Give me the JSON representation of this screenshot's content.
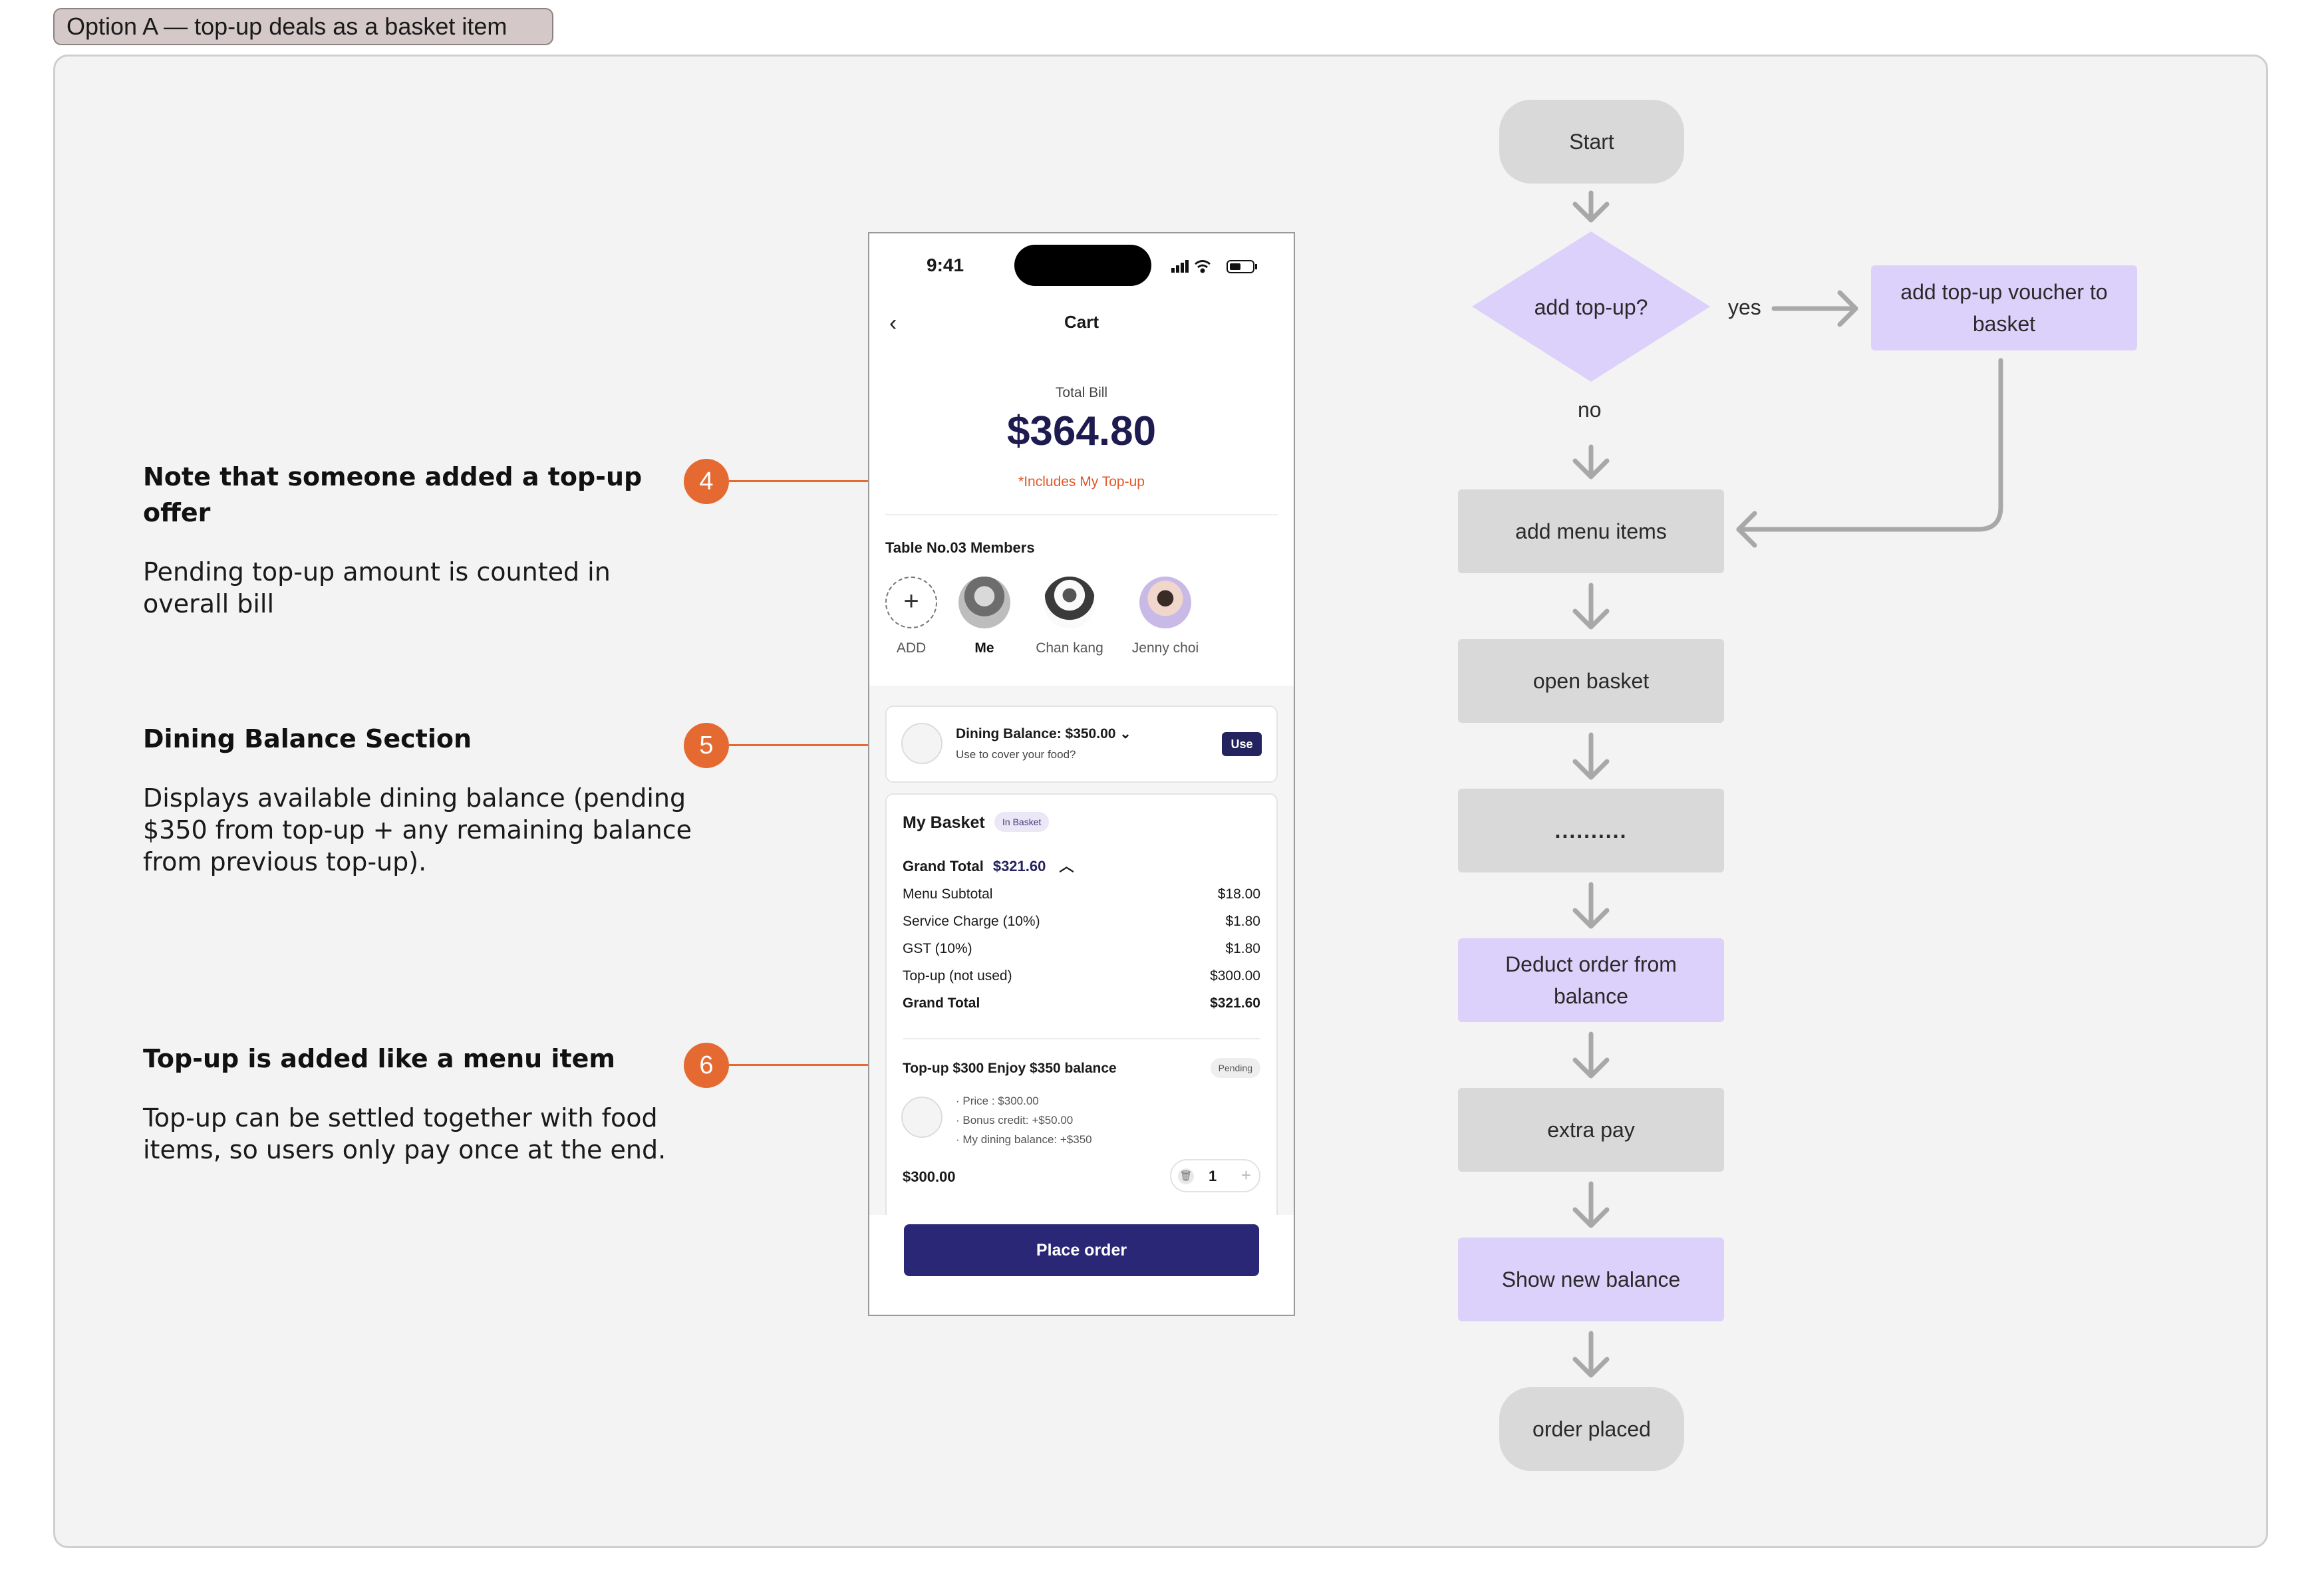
{
  "frame_title": "Option A — top-up deals as a basket item",
  "annotations": [
    {
      "number": "4",
      "title": "Note that someone added a top-up offer",
      "body": "Pending top-up amount is counted in overall bill"
    },
    {
      "number": "5",
      "title": "Dining Balance Section",
      "body": "Displays available dining balance (pending $350 from top-up + any remaining balance from previous top-up)."
    },
    {
      "number": "6",
      "title": "Top-up is added like a menu item",
      "body": "Top-up can be settled together with food items, so users only pay once at the end."
    }
  ],
  "phone": {
    "time": "9:41",
    "back_icon": "chevron-left-icon",
    "title": "Cart",
    "total_label": "Total Bill",
    "total_amount": "$364.80",
    "includes_note": "*Includes My Top-up",
    "members_title": "Table No.03 Members",
    "members": [
      {
        "label": "ADD",
        "icon": "plus-icon"
      },
      {
        "label": "Me"
      },
      {
        "label": "Chan kang"
      },
      {
        "label": "Jenny choi"
      }
    ],
    "dining_balance": {
      "label": "Dining Balance: $350.00",
      "sub": "Use to cover your food?",
      "button": "Use"
    },
    "basket": {
      "title": "My Basket",
      "badge": "In Basket",
      "grand_total_label": "Grand Total",
      "grand_total_value": "$321.60",
      "lines": [
        {
          "label": "Menu Subtotal",
          "value": "$18.00"
        },
        {
          "label": "Service Charge (10%)",
          "value": "$1.80"
        },
        {
          "label": "GST (10%)",
          "value": "$1.80"
        },
        {
          "label": "Top-up (not used)",
          "value": "$300.00"
        },
        {
          "label": "Grand Total",
          "value": "$321.60"
        }
      ],
      "topup": {
        "title": "Top-up $300 Enjoy $350 balance",
        "status": "Pending",
        "details": [
          "· Price : $300.00",
          "· Bonus credit: +$50.00",
          "· My dining balance: +$350"
        ],
        "price": "$300.00",
        "quantity": "1"
      }
    },
    "place_order": "Place order"
  },
  "flowchart": {
    "start": "Start",
    "decision": "add top-up?",
    "yes_label": "yes",
    "no_label": "no",
    "yes_action": "add top-up voucher to basket",
    "steps": [
      "add menu items",
      "open basket",
      "..........",
      "Deduct order from balance",
      "extra pay",
      "Show new balance"
    ],
    "end": "order placed"
  },
  "colors": {
    "accent_orange": "#e56a32",
    "primary_navy": "#2a2876",
    "flow_purple": "#dcd1fb",
    "flow_grey": "#d9d9d9"
  }
}
